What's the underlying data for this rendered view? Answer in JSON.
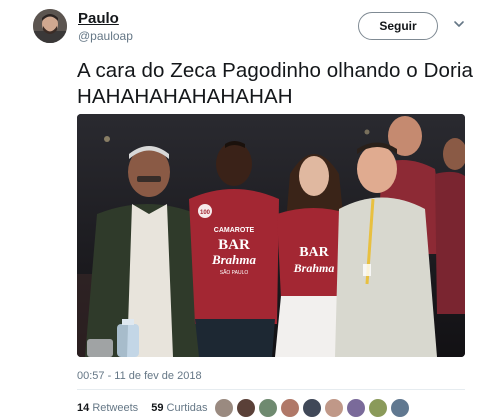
{
  "user": {
    "name": "Paulo",
    "handle": "@pauloap"
  },
  "follow_button": {
    "label": "Seguir"
  },
  "tweet": {
    "text": "A cara do Zeca Pagodinho olhando o Doria HAHAHAHAHAHAHAH",
    "timestamp": "00:57 - 11 de fev de 2018"
  },
  "media": {
    "shirt_brand": "BAR",
    "shirt_brand2": "Brahma",
    "shirt_top": "CAMAROTE",
    "shirt_bottom": "SÃO PAULO",
    "shirt_number": "100"
  },
  "stats": {
    "retweets_count": "14",
    "retweets_label": "Retweets",
    "likes_count": "59",
    "likes_label": "Curtidas"
  },
  "colors": {
    "text": "#14171a",
    "muted": "#657786",
    "shirt_red": "#a32733"
  }
}
